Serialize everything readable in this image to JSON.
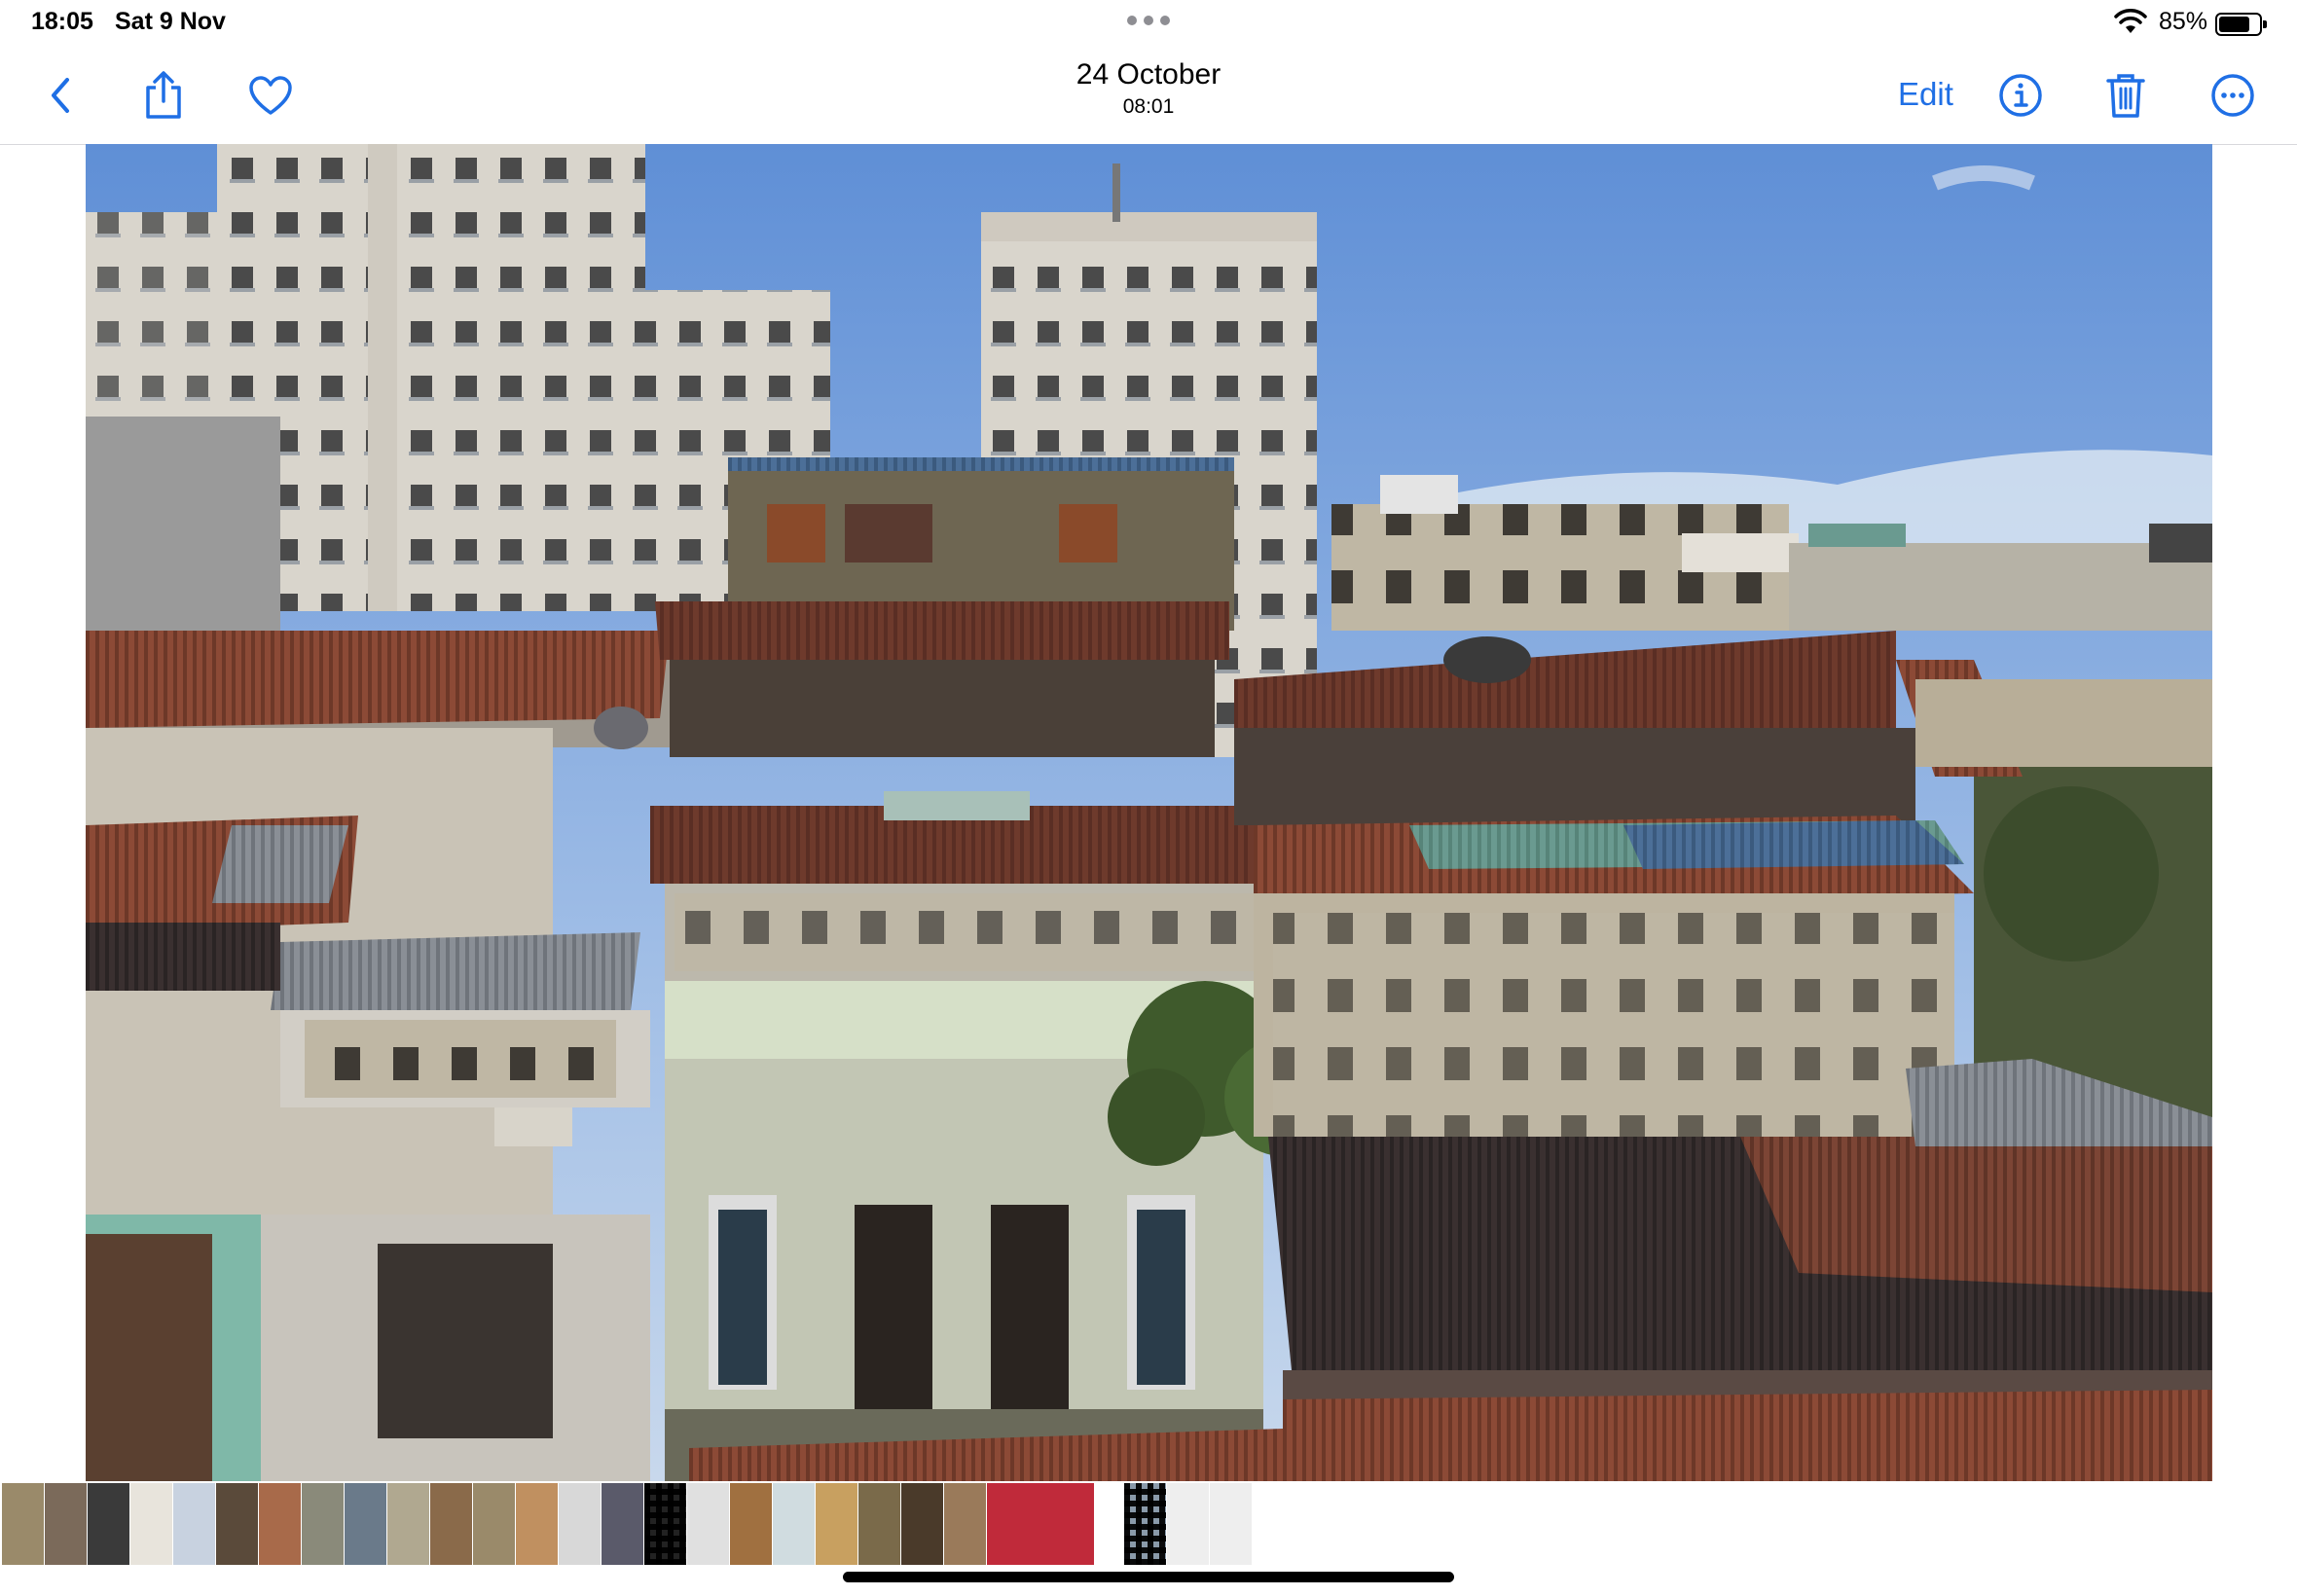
{
  "status_bar": {
    "time": "18:05",
    "date": "Sat 9 Nov",
    "battery_percent": "85%",
    "battery_level": 0.85
  },
  "nav": {
    "back_icon": "chevron-left-icon",
    "share_icon": "share-icon",
    "favorite_icon": "heart-icon",
    "title": "24 October",
    "subtitle": "08:01",
    "edit_label": "Edit",
    "info_icon": "info-icon",
    "delete_icon": "trash-icon",
    "more_icon": "ellipsis-circle-icon",
    "accent_color": "#1f6fe5"
  },
  "photo": {
    "subject": "cityscape"
  },
  "filmstrip": {
    "thumbnail_count": 27,
    "thumbnails": [
      {
        "tone": "#9a8a6a"
      },
      {
        "tone": "#7b6a5a"
      },
      {
        "tone": "#3a3a3a"
      },
      {
        "tone": "#e8e4dc"
      },
      {
        "tone": "#c8d2e0"
      },
      {
        "tone": "#5a4a3a"
      },
      {
        "tone": "#a86a4a"
      },
      {
        "tone": "#8a8a7a"
      },
      {
        "tone": "#6a7a8a"
      },
      {
        "tone": "#b0a890"
      },
      {
        "tone": "#8a6a4a"
      },
      {
        "tone": "#9a8a6a"
      },
      {
        "tone": "#c09060"
      },
      {
        "tone": "#d8d8d8"
      },
      {
        "tone": "#5a5a6a"
      },
      {
        "tone": "#222222"
      },
      {
        "tone": "#e0e0e0"
      },
      {
        "tone": "#a07040"
      },
      {
        "tone": "#d0dce0"
      },
      {
        "tone": "#c8a060"
      },
      {
        "tone": "#7a6a4a"
      },
      {
        "tone": "#4a3a2a"
      },
      {
        "tone": "#9a7a5a"
      },
      {
        "tone": "#c02a3a"
      },
      {
        "tone": "#8a9aaa"
      },
      {
        "tone": "#eeeeee"
      },
      {
        "tone": "#eeeeee"
      }
    ]
  }
}
